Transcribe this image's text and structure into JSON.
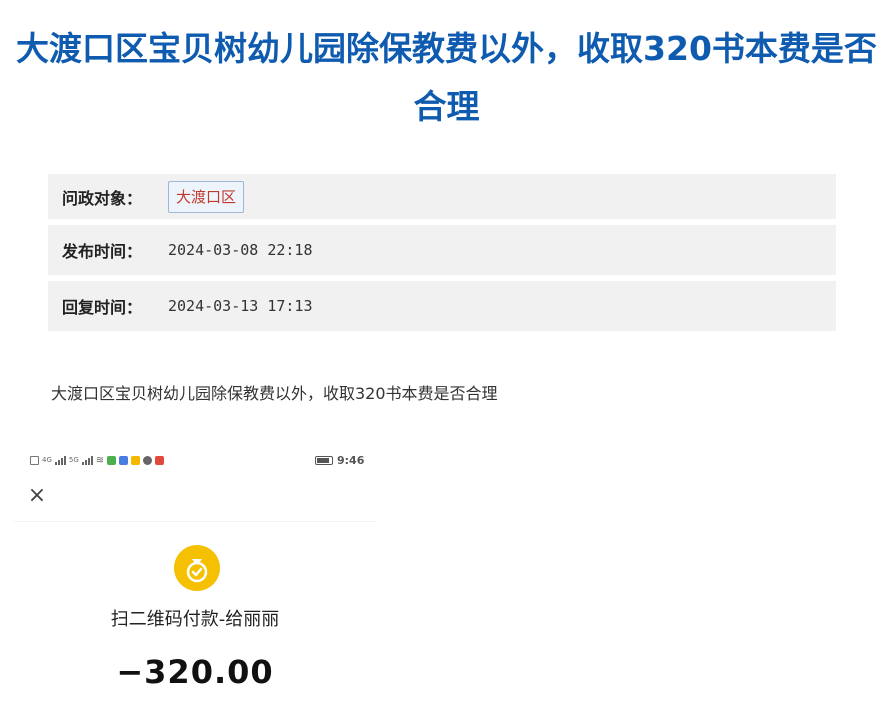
{
  "header": {
    "title": "大渡口区宝贝树幼儿园除保教费以外，收取320书本费是否合理"
  },
  "meta": {
    "target_label": "问政对象：",
    "target_tag": "大渡口区",
    "publish_label": "发布时间：",
    "publish_time": "2024-03-08 22:18",
    "reply_label": "回复时间：",
    "reply_time": "2024-03-13 17:13"
  },
  "content": {
    "text": "大渡口区宝贝树幼儿园除保教费以外，收取320书本费是否合理"
  },
  "screenshot": {
    "status_time": "9:46",
    "signal_text_1": "4G",
    "signal_text_2": "5G",
    "close_icon": "close-icon",
    "payment_icon": "coin-icon",
    "pay_label": "扫二维码付款-给丽丽",
    "amount": "−320.00"
  },
  "colors": {
    "title": "#0e5bb0",
    "tag_text": "#c0392b",
    "row_bg": "#f1f1f1",
    "coin": "#f5c000"
  }
}
